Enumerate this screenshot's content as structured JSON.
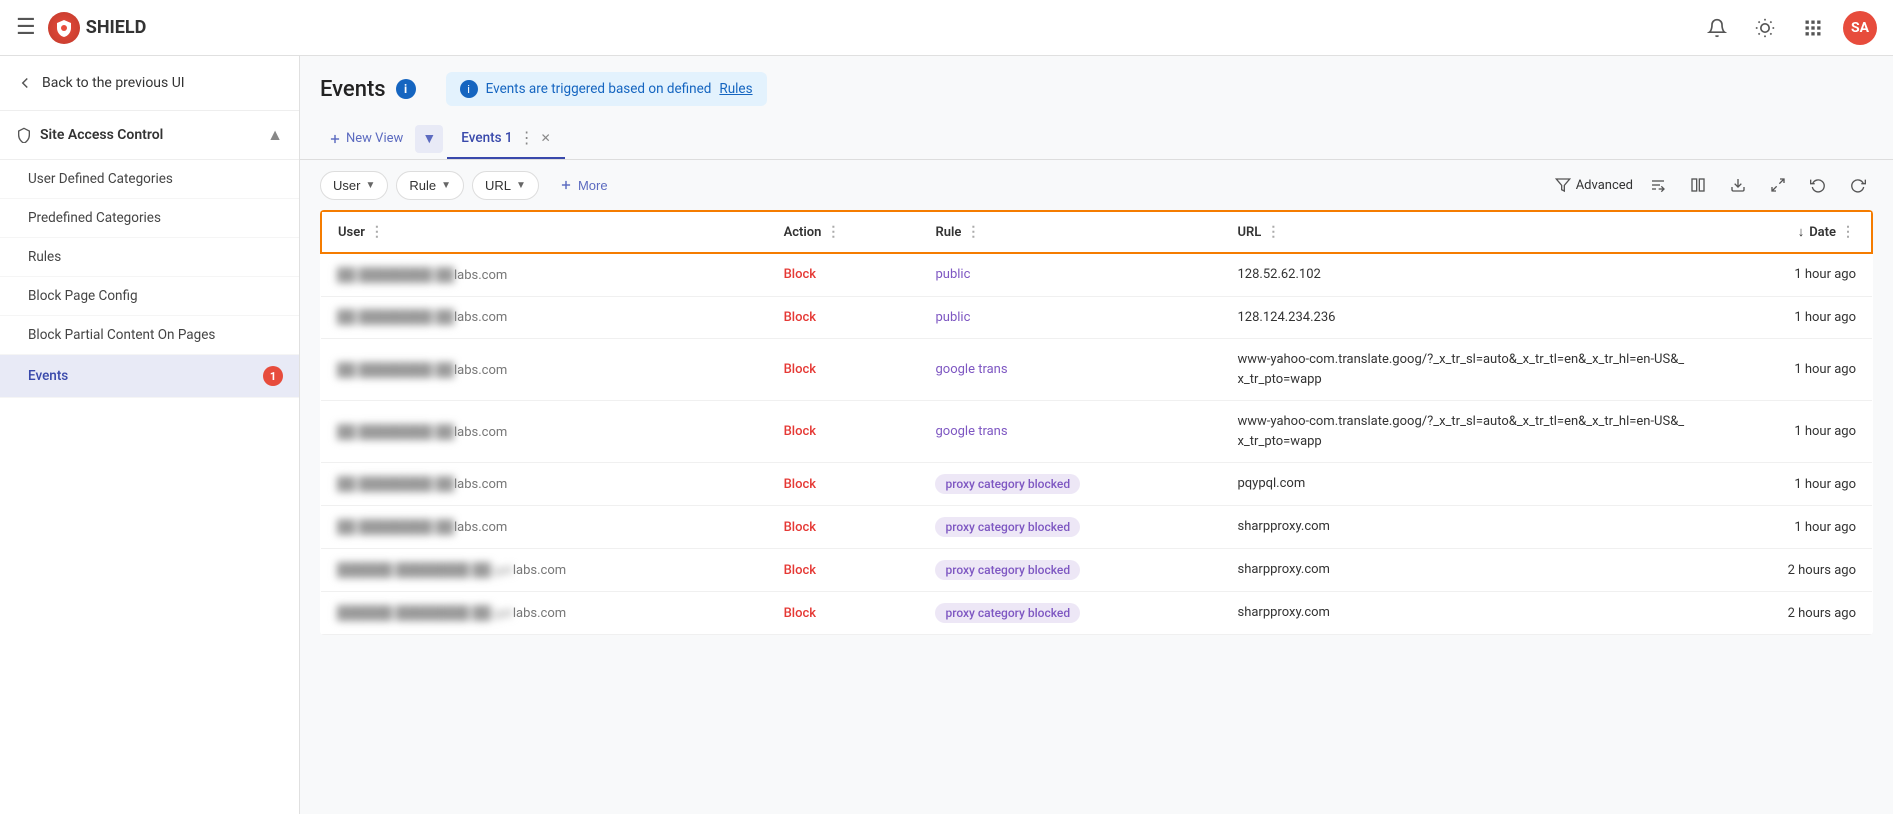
{
  "app": {
    "title": "SHIELD",
    "avatar": "SA"
  },
  "topnav": {
    "menu_icon": "☰",
    "notification_icon": "🔔",
    "brightness_icon": "☀",
    "apps_icon": "⋮⋮"
  },
  "sidebar": {
    "back_label": "Back to the previous UI",
    "section_label": "Site Access Control",
    "items": [
      {
        "id": "user-defined-categories",
        "label": "User Defined Categories",
        "active": false
      },
      {
        "id": "predefined-categories",
        "label": "Predefined Categories",
        "active": false
      },
      {
        "id": "rules",
        "label": "Rules",
        "active": false
      },
      {
        "id": "block-page-config",
        "label": "Block Page Config",
        "active": false
      },
      {
        "id": "block-partial-content",
        "label": "Block Partial Content On Pages",
        "active": false
      },
      {
        "id": "events",
        "label": "Events",
        "active": true,
        "badge": "1"
      }
    ]
  },
  "page": {
    "title": "Events",
    "info_banner": "Events are triggered based on defined",
    "info_link": "Rules"
  },
  "tabs": {
    "add_label": "New View",
    "items": [
      {
        "id": "events-1",
        "label": "Events 1",
        "active": true
      }
    ]
  },
  "toolbar": {
    "filters": [
      {
        "id": "user",
        "label": "User"
      },
      {
        "id": "rule",
        "label": "Rule"
      },
      {
        "id": "url",
        "label": "URL"
      }
    ],
    "more_label": "More",
    "advanced_label": "Advanced"
  },
  "table": {
    "columns": [
      {
        "id": "user",
        "label": "User"
      },
      {
        "id": "action",
        "label": "Action"
      },
      {
        "id": "rule",
        "label": "Rule"
      },
      {
        "id": "url",
        "label": "URL"
      },
      {
        "id": "date",
        "label": "Date",
        "sort": "desc"
      }
    ],
    "rows": [
      {
        "user": "██ ████████ ██labs.com",
        "action": "Block",
        "rule": "public",
        "rule_type": "link",
        "url": "128.52.62.102",
        "date": "1 hour ago"
      },
      {
        "user": "██ ████████ ██labs.com",
        "action": "Block",
        "rule": "public",
        "rule_type": "link",
        "url": "128.124.234.236",
        "date": "1 hour ago"
      },
      {
        "user": "██ ████████ ██labs.com",
        "action": "Block",
        "rule": "google trans",
        "rule_type": "link",
        "url": "www-yahoo-com.translate.goog/?_x_tr_sl=auto&_x_tr_tl=en&_x_tr_hl=en-US&_x_tr_pto=wapp",
        "date": "1 hour ago"
      },
      {
        "user": "██ ████████ ██labs.com",
        "action": "Block",
        "rule": "google trans",
        "rule_type": "link",
        "url": "www-yahoo-com.translate.goog/?_x_tr_sl=auto&_x_tr_tl=en&_x_tr_hl=en-US&_x_tr_pto=wapp",
        "date": "1 hour ago"
      },
      {
        "user": "██ ████████ ██labs.com",
        "action": "Block",
        "rule": "proxy category blocked",
        "rule_type": "badge",
        "url": "pqypql.com",
        "date": "1 hour ago"
      },
      {
        "user": "██ ████████ ██labs.com",
        "action": "Block",
        "rule": "proxy category blocked",
        "rule_type": "badge",
        "url": "sharpproxy.com",
        "date": "1 hour ago"
      },
      {
        "user": "██████ ████████ ██.gatlabs.com",
        "action": "Block",
        "rule": "proxy category blocked",
        "rule_type": "badge",
        "url": "sharpproxy.com",
        "date": "2 hours ago"
      },
      {
        "user": "██████ ████████ ██.gatlabs.com",
        "action": "Block",
        "rule": "proxy category blocked",
        "rule_type": "badge",
        "url": "sharpproxy.com",
        "date": "2 hours ago"
      }
    ]
  }
}
